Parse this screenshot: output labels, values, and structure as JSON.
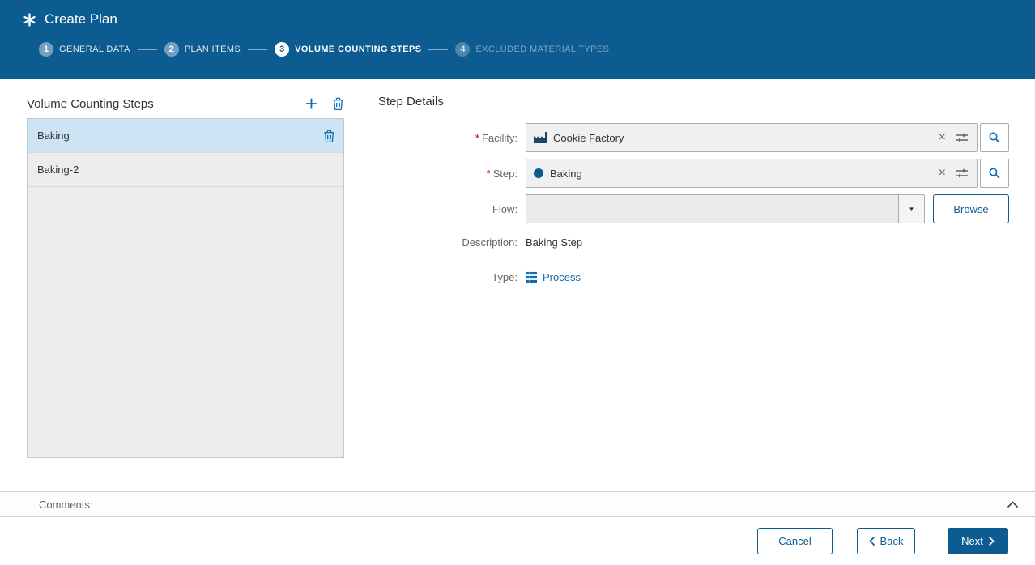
{
  "header": {
    "title": "Create Plan",
    "steps": [
      {
        "number": "1",
        "label": "GENERAL DATA",
        "state": "completed"
      },
      {
        "number": "2",
        "label": "PLAN ITEMS",
        "state": "completed"
      },
      {
        "number": "3",
        "label": "VOLUME COUNTING STEPS",
        "state": "active"
      },
      {
        "number": "4",
        "label": "EXCLUDED MATERIAL TYPES",
        "state": "upcoming"
      }
    ]
  },
  "list_panel": {
    "title": "Volume Counting Steps",
    "items": [
      {
        "label": "Baking",
        "selected": true
      },
      {
        "label": "Baking-2",
        "selected": false
      }
    ]
  },
  "details": {
    "title": "Step Details",
    "facility": {
      "label": "Facility:",
      "required": true,
      "value": "Cookie Factory"
    },
    "step": {
      "label": "Step:",
      "required": true,
      "value": "Baking"
    },
    "flow": {
      "label": "Flow:",
      "value": "",
      "browse_label": "Browse"
    },
    "description": {
      "label": "Description:",
      "value": "Baking Step"
    },
    "type": {
      "label": "Type:",
      "value": "Process"
    }
  },
  "comments": {
    "label": "Comments:"
  },
  "footer": {
    "cancel_label": "Cancel",
    "back_label": "Back",
    "next_label": "Next"
  },
  "symbols": {
    "required": "*"
  },
  "icons": {
    "create_plan": "asterisk-burst",
    "add": "+",
    "delete": "trash-can",
    "clear": "×",
    "value_help": "filter-sliders",
    "search": "magnifier",
    "facility": "factory",
    "step": "filled-circle",
    "dropdown": "▼",
    "type_process": "grid-list",
    "collapse": "chevron-up",
    "back": "chevron-left",
    "next": "chevron-right"
  },
  "colors": {
    "header_bg": "#0d5c91",
    "accent": "#0d5c91",
    "link_blue": "#0e6cb4",
    "selected_bg": "#cde4f4"
  }
}
